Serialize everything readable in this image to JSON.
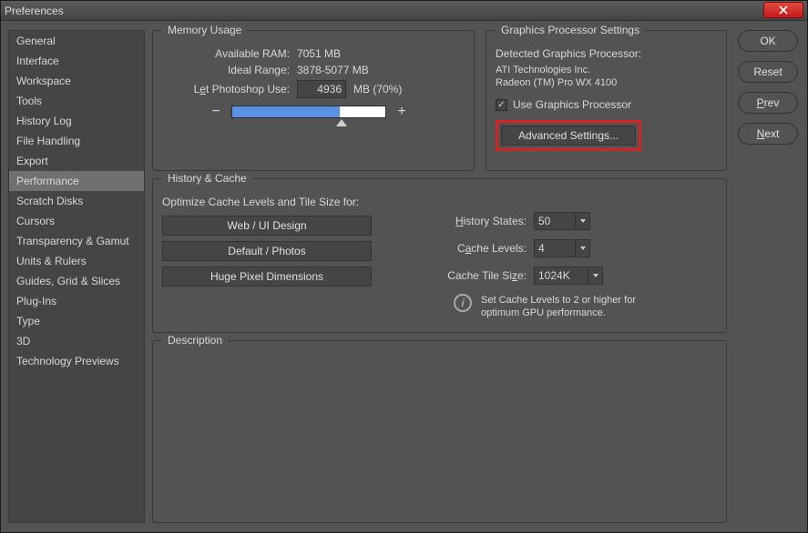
{
  "window": {
    "title": "Preferences"
  },
  "sidebar": {
    "items": [
      {
        "label": "General"
      },
      {
        "label": "Interface"
      },
      {
        "label": "Workspace"
      },
      {
        "label": "Tools"
      },
      {
        "label": "History Log"
      },
      {
        "label": "File Handling"
      },
      {
        "label": "Export"
      },
      {
        "label": "Performance"
      },
      {
        "label": "Scratch Disks"
      },
      {
        "label": "Cursors"
      },
      {
        "label": "Transparency & Gamut"
      },
      {
        "label": "Units & Rulers"
      },
      {
        "label": "Guides, Grid & Slices"
      },
      {
        "label": "Plug-Ins"
      },
      {
        "label": "Type"
      },
      {
        "label": "3D"
      },
      {
        "label": "Technology Previews"
      }
    ],
    "selected_index": 7
  },
  "buttons": {
    "ok": "OK",
    "reset": "Reset",
    "prev": "Prev",
    "next": "Next"
  },
  "memory": {
    "legend": "Memory Usage",
    "available_label": "Available RAM:",
    "available_value": "7051 MB",
    "ideal_label": "Ideal Range:",
    "ideal_value": "3878-5077 MB",
    "use_label_prefix": "L",
    "use_label_u": "e",
    "use_label_suffix": "t Photoshop Use:",
    "use_value": "4936",
    "use_unit": "MB (70%)",
    "minus": "−",
    "plus": "+",
    "slider_percent": 70
  },
  "gpu": {
    "legend": "Graphics Processor Settings",
    "detected_label": "Detected Graphics Processor:",
    "vendor": "ATI Technologies Inc.",
    "model": "Radeon (TM) Pro WX 4100",
    "use_gpu_label": "Use Graphics Processor",
    "use_gpu_checked": true,
    "advanced_label": "Advanced Settings..."
  },
  "history": {
    "legend": "History & Cache",
    "optimize_label": "Optimize Cache Levels and Tile Size for:",
    "presets": [
      "Web / UI Design",
      "Default / Photos",
      "Huge Pixel Dimensions"
    ],
    "history_states_label_pre": "",
    "history_states_u": "H",
    "history_states_label_post": "istory States:",
    "history_states_value": "50",
    "cache_levels_label_pre": "C",
    "cache_levels_u": "a",
    "cache_levels_label_post": "che Levels:",
    "cache_levels_value": "4",
    "tile_size_label": "Cache Tile Si",
    "tile_size_u": "z",
    "tile_size_label_post": "e:",
    "tile_size_value": "1024K",
    "info_text": "Set Cache Levels to 2 or higher for optimum GPU performance."
  },
  "description": {
    "legend": "Description"
  }
}
